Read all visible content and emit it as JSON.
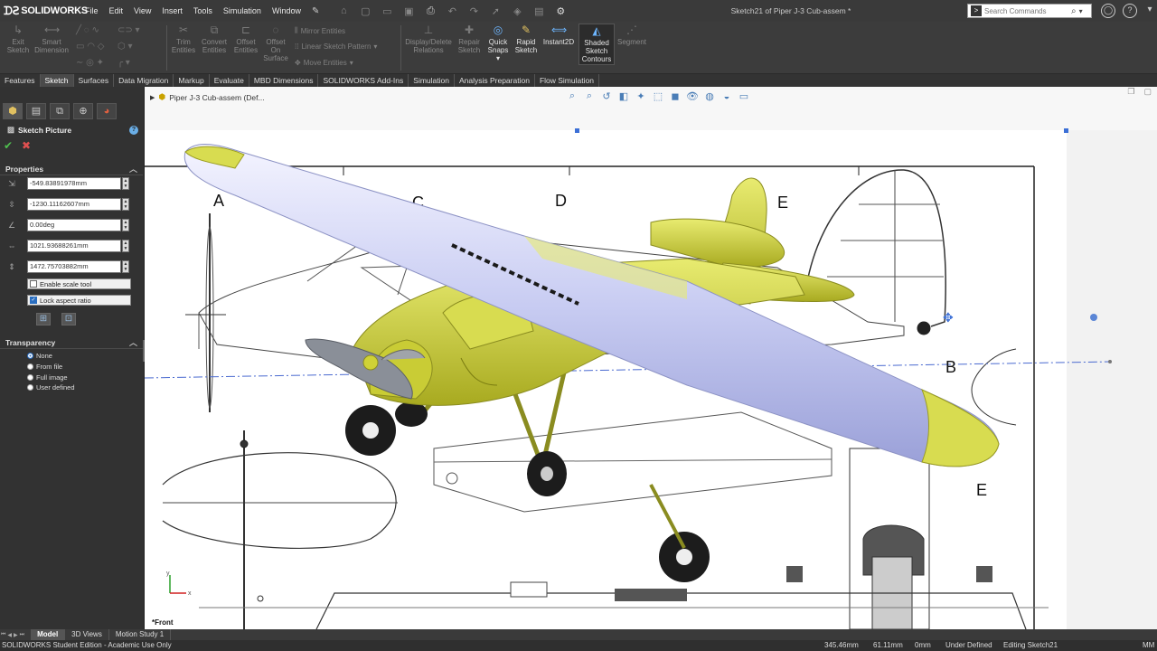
{
  "app": {
    "brand": "SOLIDWORKS",
    "doc_title": "Sketch21 of Piper J-3 Cub-assem *",
    "search_placeholder": "Search Commands"
  },
  "menu": [
    "File",
    "Edit",
    "View",
    "Insert",
    "Tools",
    "Simulation",
    "Window"
  ],
  "commands": {
    "exit_sketch": "Exit\nSketch",
    "smart_dimension": "Smart\nDimension",
    "trim_entities": "Trim\nEntities",
    "convert_entities": "Convert\nEntities",
    "offset_entities": "Offset\nEntities",
    "offset_on_surface": "Offset\nOn\nSurface",
    "mirror_entities": "Mirror Entities",
    "linear_sketch_pattern": "Linear Sketch Pattern",
    "move_entities": "Move Entities",
    "display_delete_relations": "Display/Delete\nRelations",
    "repair_sketch": "Repair\nSketch",
    "quick_snaps": "Quick\nSnaps",
    "rapid_sketch": "Rapid\nSketch",
    "instant2d": "Instant2D",
    "shaded_sketch_contours": "Shaded\nSketch\nContours",
    "segment": "Segment"
  },
  "tabs": [
    "Features",
    "Sketch",
    "Surfaces",
    "Data Migration",
    "Markup",
    "Evaluate",
    "MBD Dimensions",
    "SOLIDWORKS Add-Ins",
    "Simulation",
    "Analysis Preparation",
    "Flow Simulation"
  ],
  "active_tab": "Sketch",
  "property_manager": {
    "title": "Sketch Picture",
    "properties_header": "Properties",
    "values": [
      "-549.83891978mm",
      "-1230.11162607mm",
      "0.00deg",
      "1021.93688261mm",
      "1472.75703882mm"
    ],
    "enable_scale_tool": "Enable scale tool",
    "lock_aspect_ratio": "Lock aspect ratio",
    "transparency_header": "Transparency",
    "transparency_options": [
      "None",
      "From file",
      "Full image",
      "User defined"
    ]
  },
  "viewport": {
    "tree_item": "Piper J-3 Cub-assem (Def...",
    "view_label": "*Front",
    "drawing_letters": [
      "A",
      "B",
      "C",
      "D",
      "E",
      "B",
      "E"
    ]
  },
  "bottom_tabs": [
    "Model",
    "3D Views",
    "Motion Study 1"
  ],
  "status": {
    "edition": "SOLIDWORKS Student Edition - Academic Use Only",
    "x": "345.46mm",
    "y": "61.11mm",
    "z": "0mm",
    "state": "Under Defined",
    "editing": "Editing Sketch21",
    "units": "MM"
  },
  "colors": {
    "plane_yellow": "#cfd236",
    "wing_blue": "#c8ccf2",
    "accent": "#2a6ec0"
  }
}
